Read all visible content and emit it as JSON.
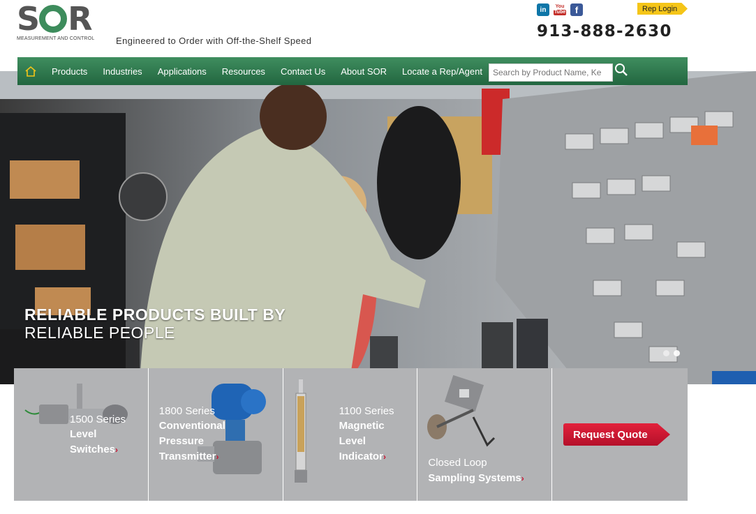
{
  "brand": {
    "logo_text": "SOR",
    "logo_sub": "MEASUREMENT AND CONTROL",
    "tagline": "Engineered to Order with Off-the-Shelf Speed"
  },
  "header": {
    "social": {
      "linkedin": "in",
      "youtube_top": "You",
      "youtube_bottom": "Tube",
      "facebook": "f"
    },
    "rep_login": "Rep Login",
    "phone": "913-888-2630"
  },
  "nav": {
    "items": [
      {
        "label": "Products"
      },
      {
        "label": "Industries"
      },
      {
        "label": "Applications"
      },
      {
        "label": "Resources"
      },
      {
        "label": "Contact Us"
      },
      {
        "label": "About SOR"
      },
      {
        "label": "Locate a Rep/Agent"
      }
    ],
    "search_placeholder": "Search by Product Name, Ke"
  },
  "hero": {
    "title": "RELIABLE PRODUCTS BUILT BY",
    "subtitle": "RELIABLE PEOPLE"
  },
  "tiles": [
    {
      "series": "1500 Series",
      "name_line1": "Level",
      "name_line2": "Switches",
      "arrow": "›"
    },
    {
      "series": "1800 Series",
      "name_line1": "Conventional",
      "name_line2": "Pressure",
      "name_line3": "Transmitter",
      "arrow": "›"
    },
    {
      "series": "1100 Series",
      "name_line1": "Magnetic",
      "name_line2": "Level",
      "name_line3": "Indicator",
      "arrow": "›"
    },
    {
      "series": "Closed Loop",
      "name_line1": "Sampling Systems",
      "arrow": "›"
    }
  ],
  "request_quote": "Request Quote",
  "colors": {
    "nav_green": "#2f7a4e",
    "logo_green": "#3d8c5c",
    "rep_login_yellow": "#f5c518",
    "cta_red": "#c8102e",
    "tile_gray": "#b2b3b5"
  }
}
